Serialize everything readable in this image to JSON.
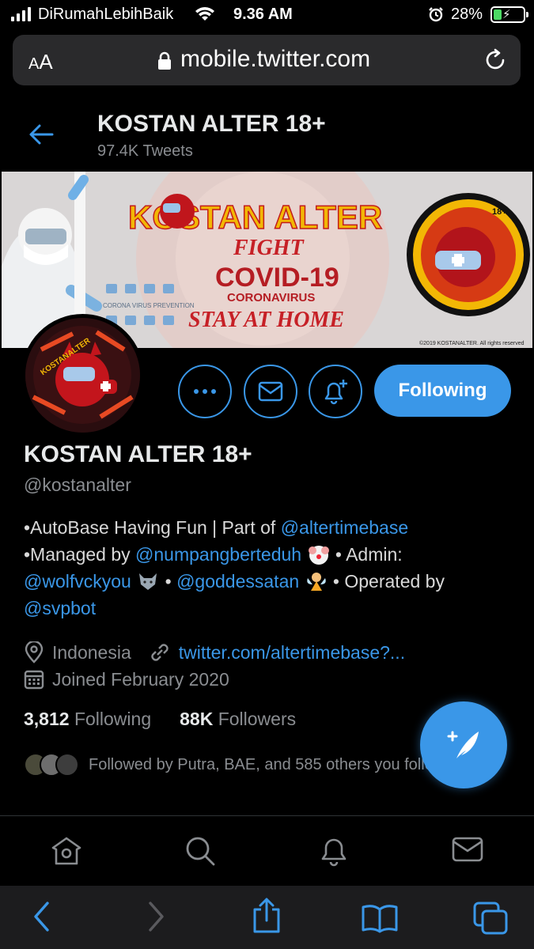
{
  "status_bar": {
    "carrier": "DiRumahLebihBaik",
    "time": "9.36 AM",
    "battery": "28%",
    "battery_level": 0.28
  },
  "browser": {
    "text_size_label_small": "A",
    "text_size_label_large": "A",
    "url": "mobile.twitter.com"
  },
  "header": {
    "title": "KOSTAN ALTER 18+",
    "tweets": "97.4K Tweets"
  },
  "banner": {
    "brand": "KOSTAN ALTER",
    "line1": "FIGHT",
    "line2": "COVID-19",
    "line3": "CORONAVIRUS",
    "line4": "STAY AT HOME",
    "prevention": "CORONA VIRUS PREVENTION",
    "badge": "18+",
    "copyright": "©2019 KOSTANALTER. All rights reserved"
  },
  "avatar": {
    "text": "KOSTANALTER"
  },
  "actions": {
    "follow_label": "Following"
  },
  "profile": {
    "name": "KOSTAN ALTER 18+",
    "handle": "@kostanalter",
    "bio": {
      "line1_text": "•AutoBase Having Fun | Part of ",
      "line1_link": "@altertimebase",
      "line2_text": "•Managed by ",
      "line2_link": "@numpangberteduh",
      "line2_after": " • Admin:",
      "line3_link1": "@wolfvckyou",
      "line3_mid": " • ",
      "line3_link2": "@goddessatan",
      "line3_after": " • Operated by",
      "line4_link": "@svpbot"
    },
    "location": "Indonesia",
    "website": "twitter.com/altertimebase?...",
    "joined": "Joined February 2020",
    "following_count": "3,812",
    "following_label": "Following",
    "followers_count": "88K",
    "followers_label": "Followers",
    "followed_by": "Followed by Putra, BAE, and 585 others you follow"
  },
  "colors": {
    "accent": "#3a97e8",
    "background": "#000000",
    "secondary_text": "#8a8d91"
  },
  "icons": {
    "compose": "compose-tweet-icon",
    "home": "home-icon",
    "search": "search-icon",
    "notifications": "bell-icon",
    "messages": "mail-icon"
  }
}
